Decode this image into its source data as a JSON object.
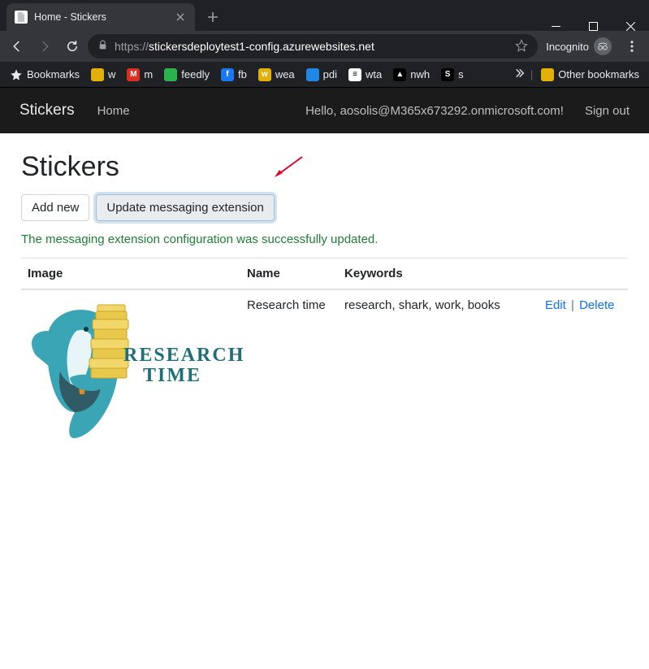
{
  "window": {
    "tab_title": "Home - Stickers"
  },
  "toolbar": {
    "url_scheme": "https://",
    "url_host": "stickersdeploytest1-config.azurewebsites.net",
    "incognito_label": "Incognito"
  },
  "bookmarks": {
    "star_label": "Bookmarks",
    "items": [
      {
        "label": "w",
        "bg": "#e2b007"
      },
      {
        "label": "m",
        "bg": "#d93025",
        "glyph": "M"
      },
      {
        "label": "feedly",
        "bg": "#2bb24c"
      },
      {
        "label": "fb",
        "bg": "#1877f2",
        "glyph": "f"
      },
      {
        "label": "wea",
        "bg": "#e2b007",
        "glyph": "w"
      },
      {
        "label": "pdi",
        "bg": "#1e88e5"
      },
      {
        "label": "wta",
        "bg": "#ffffff",
        "glyph": "≡",
        "fg": "#000"
      },
      {
        "label": "nwh",
        "bg": "#000000",
        "glyph": "▲"
      },
      {
        "label": "s",
        "bg": "#000000",
        "glyph": "S"
      }
    ],
    "other_label": "Other bookmarks"
  },
  "app": {
    "brand": "Stickers",
    "nav_home": "Home",
    "greeting": "Hello, aosolis@M365x673292.onmicrosoft.com!",
    "signout": "Sign out"
  },
  "page": {
    "title": "Stickers",
    "add_btn": "Add new",
    "update_btn": "Update messaging extension",
    "status_msg": "The messaging extension configuration was successfully updated.",
    "table": {
      "headers": {
        "image": "Image",
        "name": "Name",
        "keywords": "Keywords",
        "actions": ""
      },
      "rows": [
        {
          "name": "Research time",
          "keywords": "research, shark, work, books",
          "edit": "Edit",
          "delete": "Delete",
          "art_line1": "RESEARCH",
          "art_line2": "TIME"
        }
      ]
    }
  }
}
